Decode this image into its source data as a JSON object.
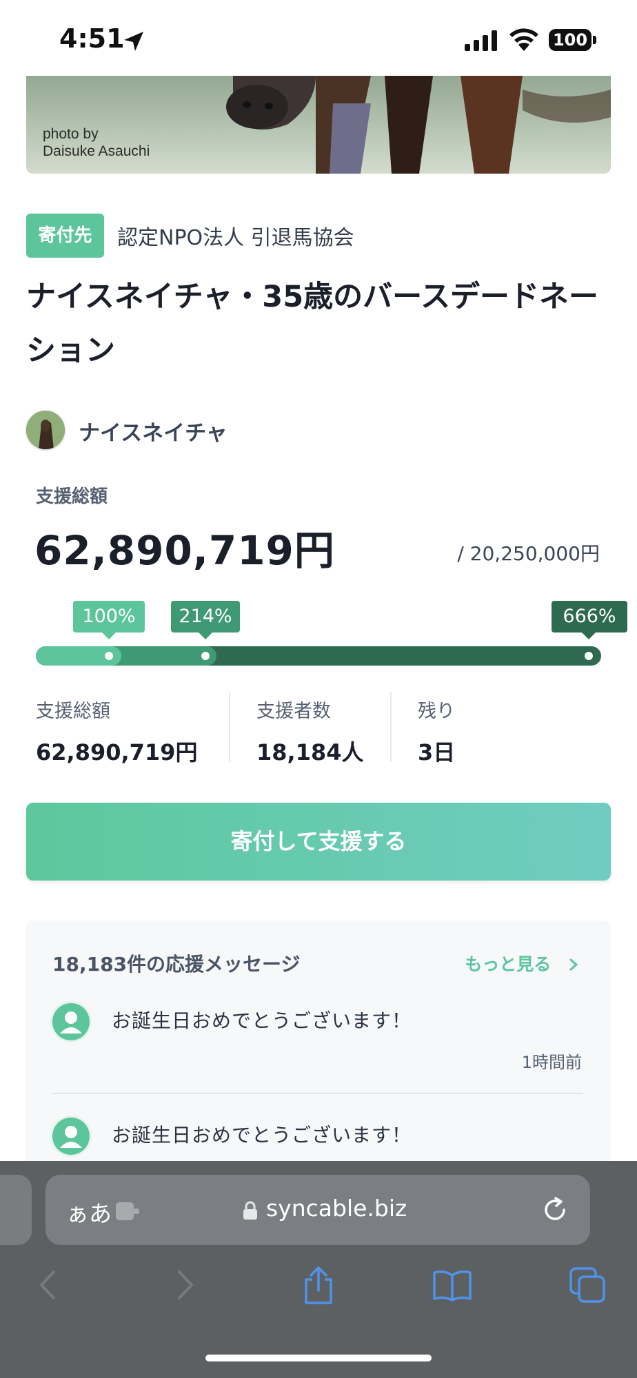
{
  "status_bar": {
    "time": "4:51",
    "battery": "100"
  },
  "hero": {
    "photo_credit_line1": "photo by",
    "photo_credit_line2": "Daisuke Asauchi"
  },
  "project": {
    "org_badge": "寄付先",
    "org_name": "認定NPO法人 引退馬協会",
    "title": "ナイスネイチャ・35歳のバースデードネーション",
    "owner_name": "ナイスネイチャ"
  },
  "funding": {
    "total_label": "支援総額",
    "total_amount": "62,890,719円",
    "goal": "/ 20,250,000円",
    "progress_percent": 666,
    "milestones": [
      {
        "label": "100%",
        "color": "#5cc59b"
      },
      {
        "label": "214%",
        "color": "#3f9a73"
      },
      {
        "label": "666%",
        "color": "#2d6a4f"
      }
    ]
  },
  "stats": [
    {
      "label": "支援総額",
      "value": "62,890,719円"
    },
    {
      "label": "支援者数",
      "value": "18,184人"
    },
    {
      "label": "残り",
      "value": "3日"
    }
  ],
  "donate_button": "寄付して支援する",
  "messages": {
    "header": "18,183件の応援メッセージ",
    "more": "もっと見る",
    "items": [
      {
        "text": "お誕生日おめでとうございます！",
        "time": "1時間前"
      },
      {
        "text": "お誕生日おめでとうございます！"
      }
    ]
  },
  "browser": {
    "aa": "ぁあ",
    "url": "syncable.biz"
  },
  "colors": {
    "accent": "#5cc59b",
    "dark_green": "#2d6a4f",
    "mid_green": "#3f9a73"
  }
}
